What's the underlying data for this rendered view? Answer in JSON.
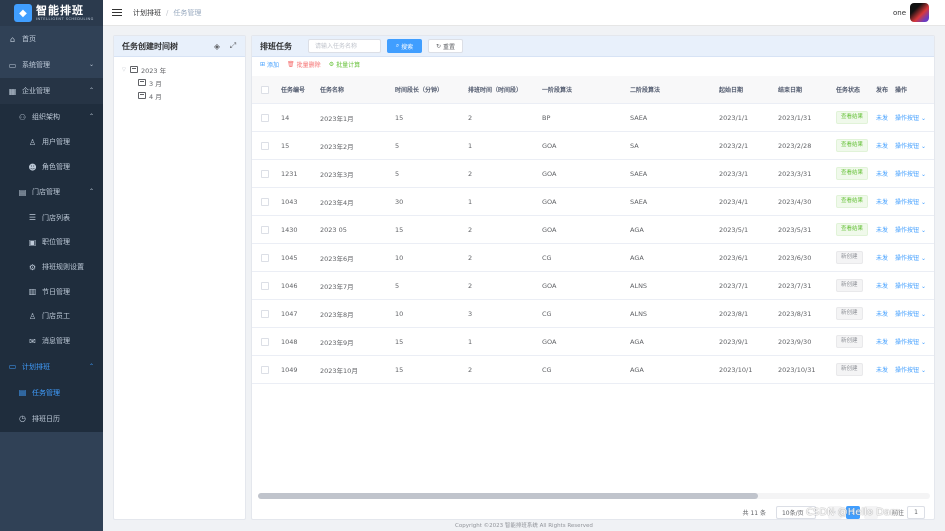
{
  "app": {
    "title": "智能排班",
    "subtitle": "INTELLIGENT SCHEDULING",
    "logo_glyph": "◆"
  },
  "sidebar": {
    "items": [
      {
        "label": "首页",
        "icon": "home-icon",
        "glyph": "⌂",
        "level": 1,
        "arrow": ""
      },
      {
        "label": "系统管理",
        "icon": "monitor-icon",
        "glyph": "▭",
        "level": 1,
        "arrow": "⌄"
      },
      {
        "label": "企业管理",
        "icon": "building-icon",
        "glyph": "▦",
        "level": 1,
        "arrow": "⌃"
      },
      {
        "label": "组织架构",
        "icon": "team-icon",
        "glyph": "⚇",
        "level": 2,
        "arrow": "⌃"
      },
      {
        "label": "用户管理",
        "icon": "user-icon",
        "glyph": "♙",
        "level": 3,
        "arrow": ""
      },
      {
        "label": "角色管理",
        "icon": "role-icon",
        "glyph": "☻",
        "level": 3,
        "arrow": ""
      },
      {
        "label": "门店管理",
        "icon": "store-icon",
        "glyph": "▤",
        "level": 2,
        "arrow": "⌃"
      },
      {
        "label": "门店列表",
        "icon": "list-icon",
        "glyph": "☰",
        "level": 3,
        "arrow": ""
      },
      {
        "label": "职位管理",
        "icon": "position-icon",
        "glyph": "▣",
        "level": 3,
        "arrow": ""
      },
      {
        "label": "排班规则设置",
        "icon": "rule-icon",
        "glyph": "⚙",
        "level": 3,
        "arrow": ""
      },
      {
        "label": "节日管理",
        "icon": "holiday-icon",
        "glyph": "▥",
        "level": 3,
        "arrow": ""
      },
      {
        "label": "门店员工",
        "icon": "staff-icon",
        "glyph": "♙",
        "level": 3,
        "arrow": ""
      },
      {
        "label": "消息管理",
        "icon": "message-icon",
        "glyph": "✉",
        "level": 3,
        "arrow": ""
      },
      {
        "label": "计划排班",
        "icon": "plan-icon",
        "glyph": "▭",
        "level": 1,
        "arrow": "⌃"
      },
      {
        "label": "任务管理",
        "icon": "task-icon",
        "glyph": "▤",
        "level": 2,
        "arrow": ""
      },
      {
        "label": "排班日历",
        "icon": "calendar-icon",
        "glyph": "◷",
        "level": 2,
        "arrow": ""
      }
    ]
  },
  "topbar": {
    "breadcrumb": [
      "计划排班",
      "任务管理"
    ],
    "separator": "/",
    "user_name": "one"
  },
  "tree_panel": {
    "title": "任务创建时间树",
    "nodes": [
      {
        "label": "2023 年",
        "expanded": true,
        "caret": "▽"
      },
      {
        "label": "3 月",
        "child": true
      },
      {
        "label": "4 月",
        "child": true
      }
    ]
  },
  "main": {
    "title": "排班任务",
    "search_placeholder": "请输入任务名称",
    "search_value": "",
    "search_button": "搜索",
    "reset_button": "重置",
    "search_glyph": "⌕",
    "reset_glyph": "↻",
    "toolbar": {
      "add": "添加",
      "batch_delete": "批量删除",
      "batch_calc": "批量计算"
    },
    "columns": [
      "任务编号",
      "任务名称",
      "时间段长（分钟）",
      "排班时间（时间段）",
      "一阶段算法",
      "二阶段算法",
      "起始日期",
      "结束日期",
      "任务状态",
      "发布",
      "操作"
    ],
    "rows": [
      {
        "id": "14",
        "name": "2023年1月",
        "slot": "15",
        "shift": "2",
        "algo1": "BP",
        "algo2": "SAEA",
        "start": "2023/1/1",
        "end": "2023/1/31",
        "status": "查看结果",
        "status_type": "done",
        "publish": "未发",
        "op": "操作按钮"
      },
      {
        "id": "15",
        "name": "2023年2月",
        "slot": "5",
        "shift": "1",
        "algo1": "GOA",
        "algo2": "SA",
        "start": "2023/2/1",
        "end": "2023/2/28",
        "status": "查看结果",
        "status_type": "done",
        "publish": "未发",
        "op": "操作按钮"
      },
      {
        "id": "1231",
        "name": "2023年3月",
        "slot": "5",
        "shift": "2",
        "algo1": "GOA",
        "algo2": "SAEA",
        "start": "2023/3/1",
        "end": "2023/3/31",
        "status": "查看结果",
        "status_type": "done",
        "publish": "未发",
        "op": "操作按钮"
      },
      {
        "id": "1043",
        "name": "2023年4月",
        "slot": "30",
        "shift": "1",
        "algo1": "GOA",
        "algo2": "SAEA",
        "start": "2023/4/1",
        "end": "2023/4/30",
        "status": "查看结果",
        "status_type": "done",
        "publish": "未发",
        "op": "操作按钮"
      },
      {
        "id": "1430",
        "name": "2023 05",
        "slot": "15",
        "shift": "2",
        "algo1": "GOA",
        "algo2": "AGA",
        "start": "2023/5/1",
        "end": "2023/5/31",
        "status": "查看结果",
        "status_type": "done",
        "publish": "未发",
        "op": "操作按钮"
      },
      {
        "id": "1045",
        "name": "2023年6月",
        "slot": "10",
        "shift": "2",
        "algo1": "CG",
        "algo2": "AGA",
        "start": "2023/6/1",
        "end": "2023/6/30",
        "status": "新创建",
        "status_type": "new",
        "publish": "未发",
        "op": "操作按钮"
      },
      {
        "id": "1046",
        "name": "2023年7月",
        "slot": "5",
        "shift": "2",
        "algo1": "GOA",
        "algo2": "ALNS",
        "start": "2023/7/1",
        "end": "2023/7/31",
        "status": "新创建",
        "status_type": "new",
        "publish": "未发",
        "op": "操作按钮"
      },
      {
        "id": "1047",
        "name": "2023年8月",
        "slot": "10",
        "shift": "3",
        "algo1": "CG",
        "algo2": "ALNS",
        "start": "2023/8/1",
        "end": "2023/8/31",
        "status": "新创建",
        "status_type": "new",
        "publish": "未发",
        "op": "操作按钮"
      },
      {
        "id": "1048",
        "name": "2023年9月",
        "slot": "15",
        "shift": "1",
        "algo1": "GOA",
        "algo2": "AGA",
        "start": "2023/9/1",
        "end": "2023/9/30",
        "status": "新创建",
        "status_type": "new",
        "publish": "未发",
        "op": "操作按钮"
      },
      {
        "id": "1049",
        "name": "2023年10月",
        "slot": "15",
        "shift": "2",
        "algo1": "CG",
        "algo2": "AGA",
        "start": "2023/10/1",
        "end": "2023/10/31",
        "status": "新创建",
        "status_type": "new",
        "publish": "未发",
        "op": "操作按钮"
      }
    ],
    "pagination": {
      "total": "共 11 条",
      "page_size": "10条/页",
      "current_page": "1",
      "goto_label": "前往",
      "goto_value": "1"
    }
  },
  "footer": {
    "copyright": "Copyright ©2023 智能排班系统 All Rights Reserved"
  },
  "watermark": "CSDN @Hello Dam",
  "colors": {
    "sidebar_bg": "#304156",
    "accent": "#409eff",
    "danger": "#f56c6c",
    "success": "#67c23a",
    "panel_header": "#e8f0fb"
  }
}
